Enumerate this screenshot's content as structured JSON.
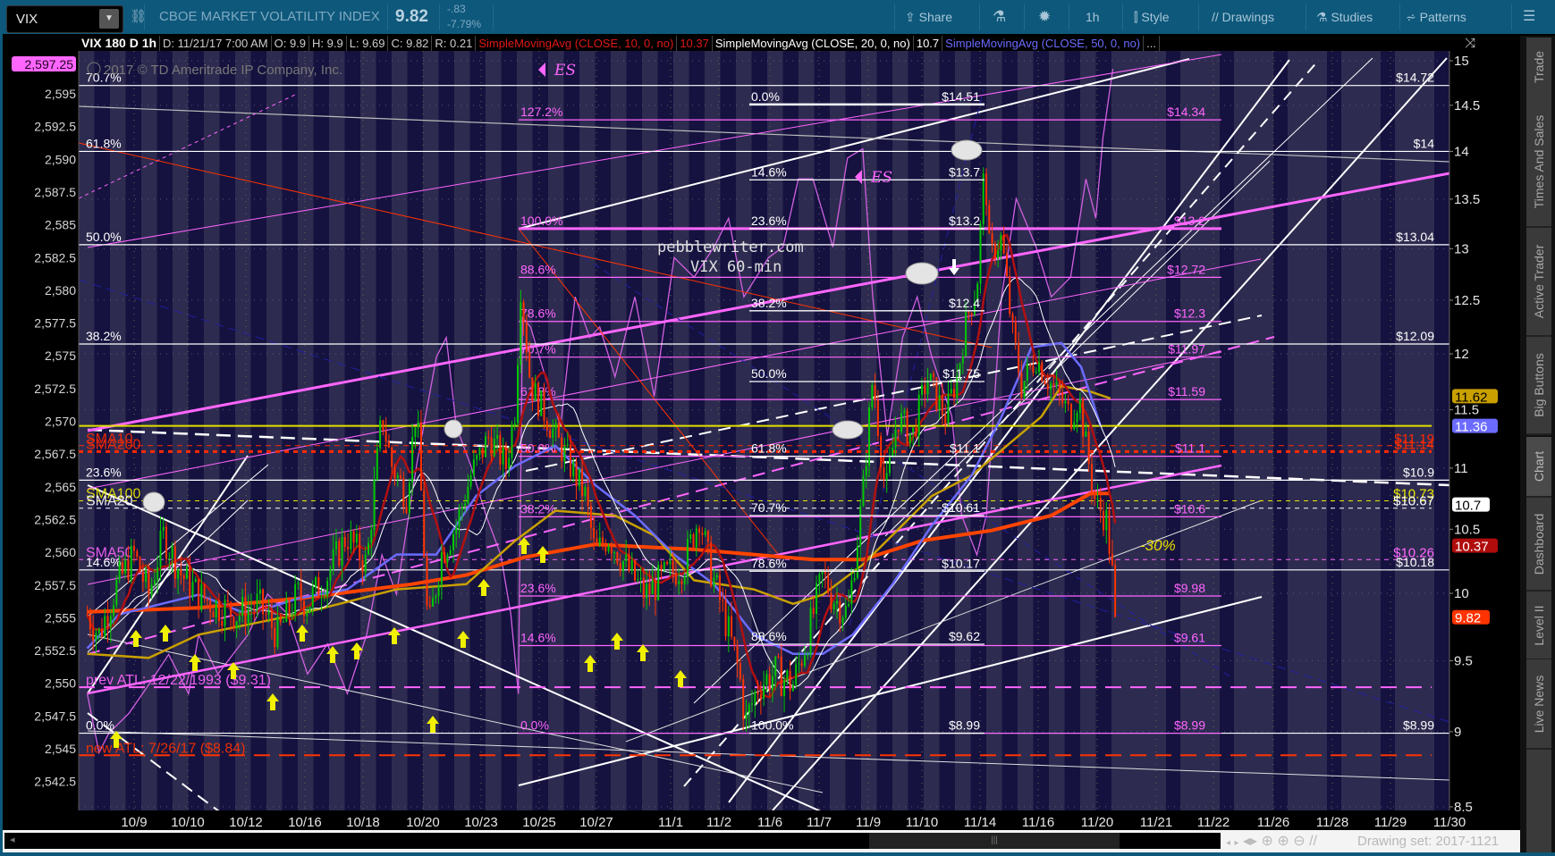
{
  "toolbar": {
    "symbol": "VIX",
    "description": "CBOE MARKET VOLATILITY INDEX",
    "last": "9.82",
    "change": "-.83",
    "change_pct": "-7.79%",
    "share": "Share",
    "timeframe": "1h",
    "style": "Style",
    "drawings": "Drawings",
    "studies": "Studies",
    "patterns": "Patterns"
  },
  "legend": {
    "title": "VIX 180 D 1h",
    "date": "D: 11/21/17 7:00 AM",
    "open": "O: 9.9",
    "high": "H: 9.9",
    "low": "L: 9.69",
    "close": "C: 9.82",
    "range": "R: 0.21",
    "sma10": "SimpleMovingAvg (CLOSE, 10, 0, no)",
    "sma10_value": "10.37",
    "sma20": "SimpleMovingAvg (CLOSE, 20, 0, no)",
    "sma20_value": "10.7",
    "sma50": "SimpleMovingAvg (CLOSE, 50, 0, no)",
    "more": "..."
  },
  "watermark": "2017 © TD Ameritrade IP Company, Inc.",
  "side_tabs": [
    "Trade",
    "Times And Sales",
    "Active Trader",
    "Big Buttons",
    "Chart",
    "Dashboard",
    "Level II",
    "Live News"
  ],
  "bottom": {
    "drawing_set": "Drawing set: 2017-1121"
  },
  "colors": {
    "up": "#00c800",
    "down": "#ff3300",
    "fib_pink": "#ff66ff",
    "sma10": "#b01010",
    "sma20": "#ffffff",
    "sma50": "#6b6bff",
    "sma100": "#c8a000",
    "sma200": "#ff4400",
    "toolbar": "#0e587b"
  },
  "chart_data": {
    "type": "candlestick",
    "title": "VIX 60-min",
    "annotation_site": "pebblewriter.com",
    "x_labels": [
      "10/9",
      "10/10",
      "10/12",
      "10/16",
      "10/18",
      "10/20",
      "10/23",
      "10/25",
      "10/27",
      "11/1",
      "11/2",
      "11/6",
      "11/7",
      "11/9",
      "11/10",
      "11/14",
      "11/16",
      "11/20",
      "11/21",
      "11/22",
      "11/26",
      "11/28",
      "11/29",
      "11/30"
    ],
    "y_right": {
      "scale": "log",
      "range": [
        8.5,
        15
      ],
      "ticks": [
        {
          "v": 15,
          "t": "15"
        },
        {
          "v": 14.5,
          "t": "14.5"
        },
        {
          "v": 14,
          "t": "14"
        },
        {
          "v": 13.5,
          "t": "13.5"
        },
        {
          "v": 13,
          "t": "13"
        },
        {
          "v": 12.5,
          "t": "12.5"
        },
        {
          "v": 12,
          "t": "12"
        },
        {
          "v": 11.5,
          "t": "11.5"
        },
        {
          "v": 11,
          "t": "11"
        },
        {
          "v": 10.5,
          "t": "10.5"
        },
        {
          "v": 10,
          "t": "10"
        },
        {
          "v": 9.5,
          "t": "9.5"
        },
        {
          "v": 9,
          "t": "9"
        },
        {
          "v": 8.5,
          "t": "8.5"
        }
      ]
    },
    "y_left": {
      "series": "ES",
      "range": [
        2541,
        2598
      ],
      "ticks": [
        {
          "v": 2595,
          "t": "2,595"
        },
        {
          "v": 2592.5,
          "t": "2,592.5"
        },
        {
          "v": 2590,
          "t": "2,590"
        },
        {
          "v": 2587.5,
          "t": "2,587.5"
        },
        {
          "v": 2585,
          "t": "2,585"
        },
        {
          "v": 2582.5,
          "t": "2,582.5"
        },
        {
          "v": 2580,
          "t": "2,580"
        },
        {
          "v": 2577.5,
          "t": "2,577.5"
        },
        {
          "v": 2575,
          "t": "2,575"
        },
        {
          "v": 2572.5,
          "t": "2,572.5"
        },
        {
          "v": 2570,
          "t": "2,570"
        },
        {
          "v": 2567.5,
          "t": "2,567.5"
        },
        {
          "v": 2565,
          "t": "2,565"
        },
        {
          "v": 2562.5,
          "t": "2,562.5"
        },
        {
          "v": 2560,
          "t": "2,560"
        },
        {
          "v": 2557.5,
          "t": "2,557.5"
        },
        {
          "v": 2555,
          "t": "2,555"
        },
        {
          "v": 2552.5,
          "t": "2,552.5"
        },
        {
          "v": 2550,
          "t": "2,550"
        },
        {
          "v": 2547.5,
          "t": "2,547.5"
        },
        {
          "v": 2545,
          "t": "2,545"
        },
        {
          "v": 2542.5,
          "t": "2,542.5"
        }
      ]
    },
    "left_badge": {
      "text": "2,597.25",
      "value": 2597.25
    },
    "right_badges": [
      {
        "text": "11.62",
        "value": 11.62,
        "bg": "#c9a000",
        "fg": "#000000"
      },
      {
        "text": "11.36",
        "value": 11.36,
        "bg": "#6b6bff",
        "fg": "#ffffff"
      },
      {
        "text": "10.7",
        "value": 10.7,
        "bg": "#ffffff",
        "fg": "#000000"
      },
      {
        "text": "10.37",
        "value": 10.37,
        "bg": "#b00c0c",
        "fg": "#ffffff"
      },
      {
        "text": "9.82",
        "value": 9.82,
        "bg": "#ff3300",
        "fg": "#ffffff"
      }
    ],
    "fib_outer": [
      {
        "pct": "70.7%",
        "value": 14.72,
        "label": "$14.72"
      },
      {
        "pct": "61.8%",
        "value": 14,
        "label": "$14"
      },
      {
        "pct": "50.0%",
        "value": 13.04,
        "label": "$13.04"
      },
      {
        "pct": "38.2%",
        "value": 12.09,
        "label": "$12.09"
      },
      {
        "pct": "23.6%",
        "value": 10.9,
        "label": "$10.9"
      },
      {
        "pct": "14.6%",
        "value": 10.18,
        "label": "$10.18"
      },
      {
        "pct": "0.0%",
        "value": 8.99,
        "label": "$8.99"
      }
    ],
    "fib_middle": [
      {
        "pct": "0.0%",
        "value": 14.51,
        "label": "$14.51"
      },
      {
        "pct": "14.6%",
        "value": 13.7,
        "label": "$13.7"
      },
      {
        "pct": "23.6%",
        "value": 13.2,
        "label": "$13.2"
      },
      {
        "pct": "38.2%",
        "value": 12.4,
        "label": "$12.4"
      },
      {
        "pct": "50.0%",
        "value": 11.75,
        "label": "$11.75"
      },
      {
        "pct": "61.8%",
        "value": 11.1,
        "label": "$11.1"
      },
      {
        "pct": "70.7%",
        "value": 10.61,
        "label": "$10.61"
      },
      {
        "pct": "78.6%",
        "value": 10.17,
        "label": "$10.17"
      },
      {
        "pct": "88.6%",
        "value": 9.62,
        "label": "$9.62"
      },
      {
        "pct": "100.0%",
        "value": 8.99,
        "label": "$8.99"
      }
    ],
    "fib_pink": [
      {
        "pct": "127.2%",
        "value": 14.34,
        "label": "$14.34"
      },
      {
        "pct": "100.0%",
        "value": 13.2,
        "label": "$13.2"
      },
      {
        "pct": "88.6%",
        "value": 12.72,
        "label": "$12.72"
      },
      {
        "pct": "78.6%",
        "value": 12.3,
        "label": "$12.3"
      },
      {
        "pct": "70.7%",
        "value": 11.97,
        "label": "$11.97"
      },
      {
        "pct": "61.8%",
        "value": 11.59,
        "label": "$11.59"
      },
      {
        "pct": "50.0%",
        "value": 11.1,
        "label": "$11.1"
      },
      {
        "pct": "38.2%",
        "value": 10.6,
        "label": "$10.6"
      },
      {
        "pct": "23.6%",
        "value": 9.98,
        "label": "$9.98"
      },
      {
        "pct": "14.6%",
        "value": 9.61,
        "label": "$9.61"
      },
      {
        "pct": "0.0%",
        "value": 8.99,
        "label": "$8.99"
      }
    ],
    "levels": [
      {
        "name": "SMA10",
        "value": 11.19,
        "label": "$11.19",
        "color": "#ff2a00",
        "dash": "6 5",
        "width": 1,
        "left_text": "SMA10"
      },
      {
        "name": "SMA200",
        "value": 11.14,
        "label": "$11.14",
        "color": "#ff2a00",
        "dash": "5 5",
        "width": 3,
        "left_text": "SMA200"
      },
      {
        "name": "SMA100",
        "value": 10.73,
        "label": "$10.73",
        "color": "#e8e800",
        "dash": "5 5",
        "width": 1,
        "left_text": "SMA100"
      },
      {
        "name": "SMA20",
        "value": 10.67,
        "label": "$10.67",
        "color": "#ffffff",
        "dash": "5 5",
        "width": 1,
        "left_text": "SMA20"
      },
      {
        "name": "SMA50",
        "value": 10.26,
        "label": "$10.26",
        "color": "#ff66ff",
        "dash": "5 5",
        "width": 1,
        "left_text": "SMA50"
      },
      {
        "name": "prev-atl",
        "value": 9.31,
        "label": "",
        "color": "#ff66ff",
        "dash": "18 10",
        "width": 2,
        "left_text": "prev ATL: 12/22/1993 ($9.31)"
      },
      {
        "name": "new-atl",
        "value": 8.84,
        "label": "",
        "color": "#ff3300",
        "dash": "18 10",
        "width": 2,
        "left_text": "new ATL: 7/26/17 ($8.84)"
      },
      {
        "name": "sma50-line",
        "value": 11.36,
        "label": "",
        "color": "#e0e000",
        "dash": "",
        "width": 2,
        "left_text": ""
      }
    ],
    "annotations": {
      "es_marker": "ES",
      "drop": "-30%"
    },
    "vix_path": [
      [
        -0.8,
        9.84
      ],
      [
        -0.6,
        9.69
      ],
      [
        -0.29,
        10.07
      ],
      [
        0,
        10.3
      ],
      [
        0.25,
        9.99
      ],
      [
        0.5,
        10.45
      ],
      [
        0.81,
        10.14
      ],
      [
        1.1,
        9.99
      ],
      [
        1.35,
        9.92
      ],
      [
        1.77,
        9.84
      ],
      [
        2.11,
        9.92
      ],
      [
        2.45,
        9.69
      ],
      [
        2.79,
        9.99
      ],
      [
        2.96,
        9.92
      ],
      [
        3.3,
        10.14
      ],
      [
        3.63,
        10.45
      ],
      [
        3.97,
        10.22
      ],
      [
        4.23,
        11.44
      ],
      [
        4.4,
        11.02
      ],
      [
        4.65,
        10.77
      ],
      [
        4.82,
        11.53
      ],
      [
        5.02,
        9.69
      ],
      [
        5.24,
        10.3
      ],
      [
        5.5,
        10.53
      ],
      [
        5.75,
        10.94
      ],
      [
        6.06,
        11.27
      ],
      [
        6.35,
        11.02
      ],
      [
        6.51,
        11.53
      ],
      [
        6.6,
        12.62
      ],
      [
        6.77,
        11.71
      ],
      [
        7.04,
        11.44
      ],
      [
        7.19,
        11.27
      ],
      [
        7.45,
        11.02
      ],
      [
        7.7,
        10.77
      ],
      [
        7.87,
        10.3
      ],
      [
        8.09,
        10.45
      ],
      [
        8.38,
        10.22
      ],
      [
        8.72,
        9.99
      ],
      [
        9.09,
        10.14
      ],
      [
        9.39,
        10.22
      ],
      [
        9.65,
        10.61
      ],
      [
        9.82,
        10.22
      ],
      [
        10.07,
        9.84
      ],
      [
        10.33,
        9.41
      ],
      [
        10.44,
        9.06
      ],
      [
        10.66,
        9.33
      ],
      [
        10.95,
        9.41
      ],
      [
        11.25,
        9.33
      ],
      [
        11.51,
        9.69
      ],
      [
        11.76,
        10.14
      ],
      [
        11.9,
        9.99
      ],
      [
        12.19,
        9.84
      ],
      [
        12.44,
        10.77
      ],
      [
        12.61,
        11.79
      ],
      [
        12.83,
        10.77
      ],
      [
        13.03,
        11.44
      ],
      [
        13.29,
        11.27
      ],
      [
        13.54,
        11.79
      ],
      [
        13.85,
        11.44
      ],
      [
        14.05,
        11.79
      ],
      [
        14.22,
        12.34
      ],
      [
        14.39,
        12.62
      ],
      [
        14.52,
        13.87
      ],
      [
        14.61,
        12.91
      ],
      [
        14.81,
        13.11
      ],
      [
        14.98,
        12.25
      ],
      [
        15.15,
        11.71
      ],
      [
        15.4,
        11.97
      ],
      [
        15.57,
        11.79
      ],
      [
        15.79,
        11.62
      ],
      [
        15.99,
        11.44
      ],
      [
        16.13,
        11.62
      ],
      [
        16.25,
        11.19
      ],
      [
        16.42,
        10.69
      ],
      [
        16.59,
        10.61
      ],
      [
        16.67,
        10.3
      ],
      [
        16.76,
        9.82
      ]
    ],
    "sma200_path": [
      [
        -0.8,
        9.86
      ],
      [
        1.1,
        9.89
      ],
      [
        2.79,
        9.96
      ],
      [
        4.74,
        10.07
      ],
      [
        5.67,
        10.14
      ],
      [
        6.68,
        10.28
      ],
      [
        7.87,
        10.38
      ],
      [
        9.56,
        10.34
      ],
      [
        10.58,
        10.3
      ],
      [
        11.6,
        10.26
      ],
      [
        12.44,
        10.26
      ],
      [
        13.46,
        10.41
      ],
      [
        14.64,
        10.49
      ],
      [
        15.66,
        10.61
      ],
      [
        16.33,
        10.79
      ],
      [
        16.67,
        10.79
      ]
    ],
    "sma100_path": [
      [
        -0.8,
        9.55
      ],
      [
        0.25,
        9.52
      ],
      [
        1.1,
        9.69
      ],
      [
        2.79,
        9.84
      ],
      [
        4.48,
        10.03
      ],
      [
        5.67,
        10.07
      ],
      [
        6.51,
        10.41
      ],
      [
        7.19,
        10.65
      ],
      [
        8.21,
        10.61
      ],
      [
        8.88,
        10.45
      ],
      [
        9.56,
        10.1
      ],
      [
        10.58,
        10.03
      ],
      [
        11.25,
        9.92
      ],
      [
        11.76,
        9.99
      ],
      [
        12.44,
        10.22
      ],
      [
        13.62,
        10.77
      ],
      [
        14.3,
        10.94
      ],
      [
        15.49,
        11.44
      ],
      [
        15.83,
        11.71
      ],
      [
        16.33,
        11.66
      ],
      [
        16.67,
        11.6
      ]
    ],
    "sma50_path": [
      [
        -0.8,
        9.59
      ],
      [
        -0.26,
        9.84
      ],
      [
        1.1,
        9.99
      ],
      [
        1.94,
        9.84
      ],
      [
        2.79,
        9.96
      ],
      [
        3.64,
        10.03
      ],
      [
        4.48,
        10.3
      ],
      [
        5.16,
        10.3
      ],
      [
        5.84,
        10.77
      ],
      [
        6.51,
        11.02
      ],
      [
        7.19,
        11.19
      ],
      [
        7.87,
        10.86
      ],
      [
        8.55,
        10.61
      ],
      [
        9.22,
        10.3
      ],
      [
        9.9,
        10.07
      ],
      [
        10.58,
        9.69
      ],
      [
        11.25,
        9.55
      ],
      [
        11.76,
        9.55
      ],
      [
        12.27,
        9.69
      ],
      [
        12.95,
        10.07
      ],
      [
        13.62,
        10.53
      ],
      [
        14.3,
        10.94
      ],
      [
        14.81,
        11.44
      ],
      [
        15.32,
        12.06
      ],
      [
        15.83,
        12.1
      ],
      [
        16.17,
        11.88
      ],
      [
        16.5,
        11.36
      ]
    ],
    "es_path": [
      [
        -0.8,
        2549.2
      ],
      [
        -0.6,
        2544.7
      ],
      [
        -0.43,
        2546.2
      ],
      [
        -0.09,
        2547.7
      ],
      [
        0.25,
        2549.9
      ],
      [
        0.59,
        2552.2
      ],
      [
        0.93,
        2549.2
      ],
      [
        1.1,
        2553.7
      ],
      [
        1.43,
        2550.7
      ],
      [
        1.94,
        2553.7
      ],
      [
        2.28,
        2556.8
      ],
      [
        2.62,
        2555.3
      ],
      [
        2.96,
        2550.7
      ],
      [
        3.3,
        2553.0
      ],
      [
        3.64,
        2549.2
      ],
      [
        3.97,
        2553.7
      ],
      [
        4.23,
        2559.8
      ],
      [
        4.48,
        2556.8
      ],
      [
        4.82,
        2566.6
      ],
      [
        5.16,
        2574.9
      ],
      [
        5.33,
        2576.4
      ],
      [
        5.5,
        2569.6
      ],
      [
        5.75,
        2566.6
      ],
      [
        6.01,
        2562.8
      ],
      [
        6.26,
        2559.8
      ],
      [
        6.43,
        2555.3
      ],
      [
        6.56,
        2549.2
      ],
      [
        6.63,
        2577.9
      ],
      [
        6.77,
        2577.2
      ],
      [
        7.02,
        2573.4
      ],
      [
        7.28,
        2569.6
      ],
      [
        7.53,
        2579.5
      ],
      [
        7.78,
        2576.4
      ],
      [
        7.95,
        2577.2
      ],
      [
        8.21,
        2573.4
      ],
      [
        8.55,
        2579.5
      ],
      [
        8.88,
        2571.9
      ],
      [
        9.22,
        2582.5
      ],
      [
        9.56,
        2581.0
      ],
      [
        9.9,
        2583.3
      ],
      [
        10.15,
        2585.5
      ],
      [
        10.41,
        2579.5
      ],
      [
        10.83,
        2582.5
      ],
      [
        11.08,
        2583.3
      ],
      [
        11.34,
        2588.5
      ],
      [
        11.59,
        2588.5
      ],
      [
        11.93,
        2583.3
      ],
      [
        12.18,
        2590.1
      ],
      [
        12.44,
        2590.8
      ],
      [
        12.61,
        2579.5
      ],
      [
        12.86,
        2568.9
      ],
      [
        13.12,
        2576.4
      ],
      [
        13.37,
        2579.5
      ],
      [
        13.62,
        2574.9
      ],
      [
        13.96,
        2570.4
      ],
      [
        14.13,
        2562.8
      ],
      [
        14.39,
        2559.8
      ],
      [
        14.55,
        2562.8
      ],
      [
        14.81,
        2579.5
      ],
      [
        15.06,
        2587.0
      ],
      [
        15.4,
        2583.3
      ],
      [
        15.66,
        2579.5
      ],
      [
        15.99,
        2581.0
      ],
      [
        16.25,
        2588.5
      ],
      [
        16.42,
        2585.5
      ],
      [
        16.54,
        2591.6
      ],
      [
        16.71,
        2596.9
      ]
    ]
  }
}
